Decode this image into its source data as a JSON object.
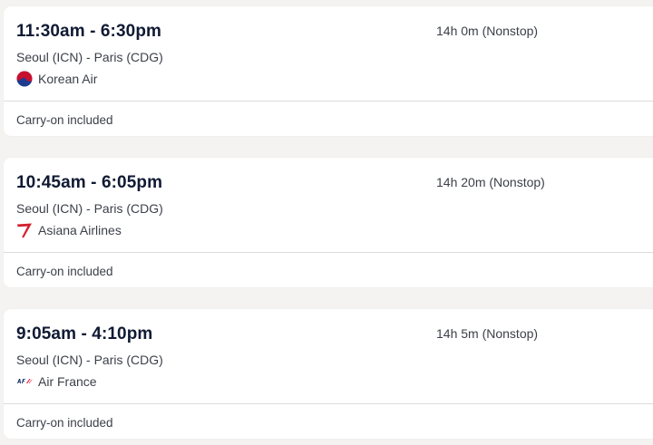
{
  "flights": [
    {
      "times": "11:30am - 6:30pm",
      "route": "Seoul (ICN) - Paris (CDG)",
      "airline": "Korean Air",
      "airline_icon": "korean-air-logo-icon",
      "duration": "14h 0m (Nonstop)",
      "baggage": "Carry-on included"
    },
    {
      "times": "10:45am - 6:05pm",
      "route": "Seoul (ICN) - Paris (CDG)",
      "airline": "Asiana Airlines",
      "airline_icon": "asiana-logo-icon",
      "duration": "14h 20m (Nonstop)",
      "baggage": "Carry-on included"
    },
    {
      "times": "9:05am - 4:10pm",
      "route": "Seoul (ICN) - Paris (CDG)",
      "airline": "Air France",
      "airline_icon": "air-france-logo-icon",
      "duration": "14h 5m (Nonstop)",
      "baggage": "Carry-on included"
    }
  ],
  "colors": {
    "page_background": "#f4f3f1",
    "card_background": "#ffffff",
    "time_text": "#101a33",
    "body_text": "#3b3f48",
    "korean_red": "#c8102e",
    "korean_blue": "#1d3c8f",
    "asiana_red": "#d3202f",
    "air_france_navy": "#002157",
    "air_france_red": "#e4002b"
  }
}
